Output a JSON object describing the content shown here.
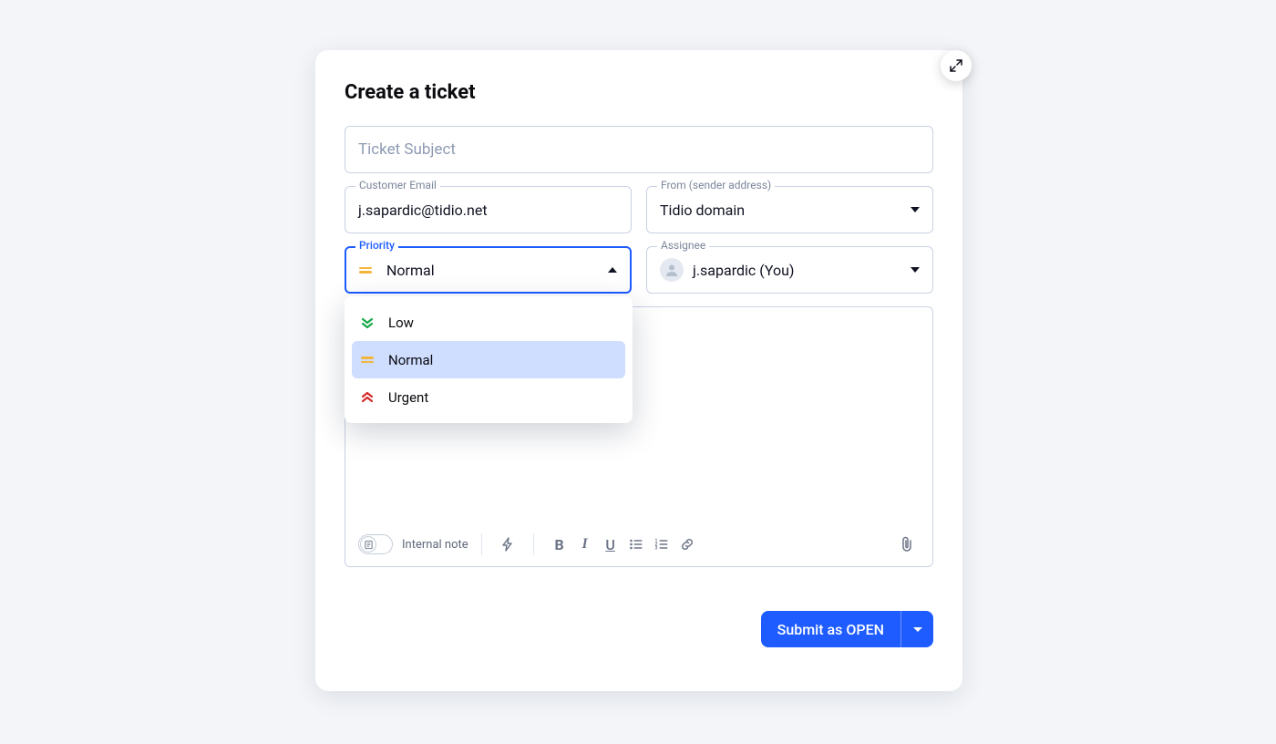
{
  "title": "Create a ticket",
  "subject": {
    "placeholder": "Ticket Subject"
  },
  "customer_email": {
    "label": "Customer Email",
    "value": "j.sapardic@tidio.net"
  },
  "from": {
    "label": "From (sender address)",
    "value": "Tidio domain"
  },
  "priority": {
    "label": "Priority",
    "value": "Normal",
    "options": [
      {
        "label": "Low"
      },
      {
        "label": "Normal"
      },
      {
        "label": "Urgent"
      }
    ]
  },
  "assignee": {
    "label": "Assignee",
    "value": "j.sapardic (You)"
  },
  "toolbar": {
    "internal_note": "Internal note"
  },
  "submit": {
    "label": "Submit as OPEN"
  }
}
